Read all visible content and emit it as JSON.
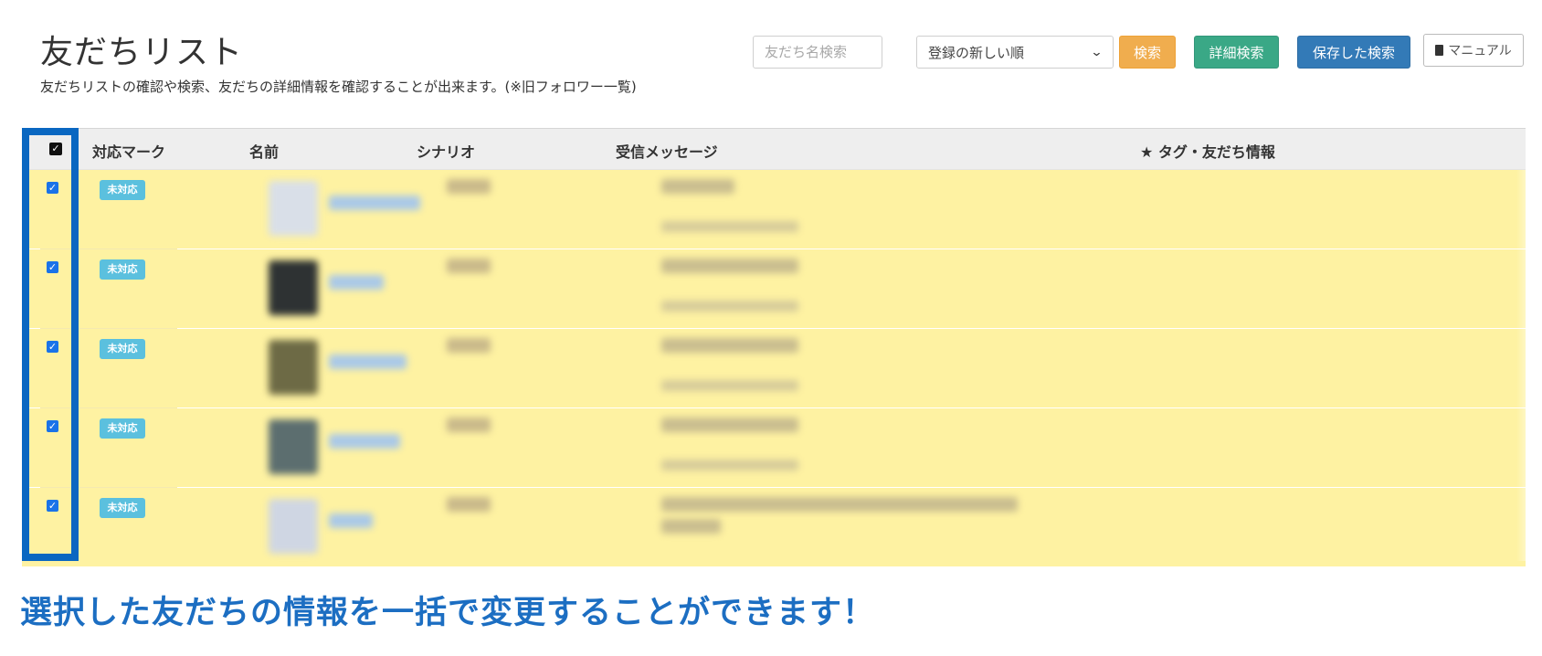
{
  "header": {
    "title": "友だちリスト",
    "subtitle": "友だちリストの確認や検索、友だちの詳細情報を確認することが出来ます。(※旧フォロワー一覧)"
  },
  "toolbar": {
    "search_placeholder": "友だち名検索",
    "sort_selected": "登録の新しい順",
    "search_label": "検索",
    "detail_search_label": "詳細検索",
    "saved_search_label": "保存した検索",
    "manual_label": "マニュアル"
  },
  "table": {
    "columns": [
      "対応マーク",
      "名前",
      "シナリオ",
      "受信メッセージ",
      "★ タグ・友だち情報"
    ],
    "header_checkbox_checked": true,
    "rows": [
      {
        "checked": true,
        "status": "未対応"
      },
      {
        "checked": true,
        "status": "未対応"
      },
      {
        "checked": true,
        "status": "未対応"
      },
      {
        "checked": true,
        "status": "未対応"
      },
      {
        "checked": true,
        "status": "未対応"
      }
    ]
  },
  "caption": "選択した友だちの情報を一括で変更することができます！",
  "colors": {
    "highlight_border": "#0a67c1",
    "row_background": "#fef2a2",
    "badge": "#5bc0de",
    "btn_search": "#f0ad4e",
    "btn_detail": "#3aa886",
    "btn_saved": "#337ab7",
    "caption": "#1c6ec2"
  },
  "icons": {
    "checkbox": "check-icon",
    "manual": "book-icon",
    "sort": "chevron-down-icon"
  }
}
